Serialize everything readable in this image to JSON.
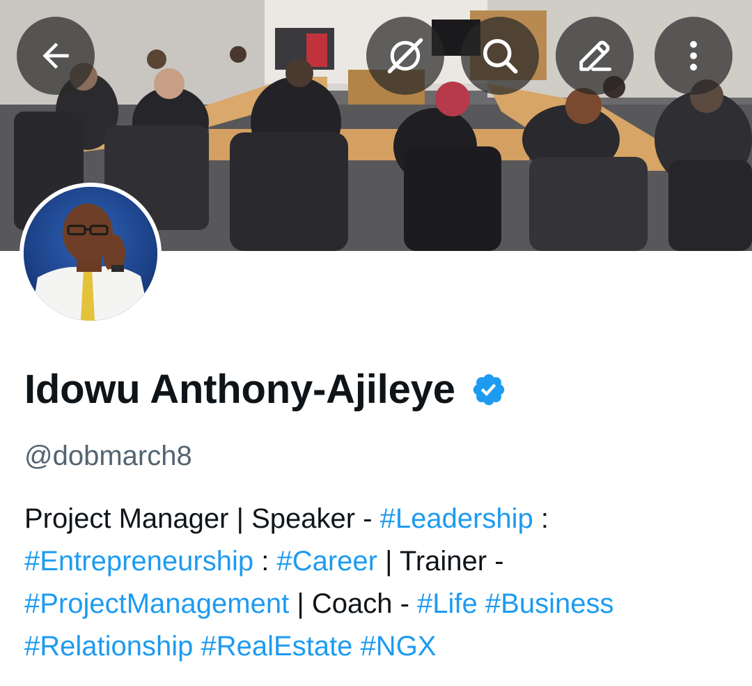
{
  "header": {
    "buttons": {
      "back": "back-arrow-icon",
      "grok": "grok-icon",
      "search": "search-icon",
      "edit": "edit-pencil-icon",
      "more": "more-vertical-icon"
    }
  },
  "profile": {
    "display_name": "Idowu Anthony-Ajileye",
    "handle": "@dobmarch8",
    "verified_color": "#1d9bf0",
    "bio": {
      "l1_text1": "Project Manager | Speaker - ",
      "l1_tag1": "#Leadership",
      "l1_text2": " :",
      "l2_tag1": "#Entrepreneurship",
      "l2_text1": " : ",
      "l2_tag2": "#Career",
      "l2_text2": " | Trainer -",
      "l3_tag1": "#ProjectManagement",
      "l3_text1": " | Coach - ",
      "l3_tag2": "#Life",
      "l3_text2": " ",
      "l3_tag3": "#Business",
      "l4_tag1": "#Relationship",
      "l4_text1": " ",
      "l4_tag2": "#RealEstate",
      "l4_text2": " ",
      "l4_tag3": "#NGX"
    }
  },
  "colors": {
    "text_primary": "#0f1419",
    "text_secondary": "#536471",
    "link": "#1d9bf0"
  }
}
